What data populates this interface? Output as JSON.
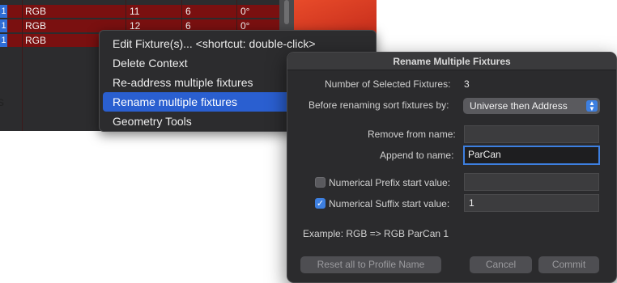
{
  "fixture_table": {
    "rows": [
      {
        "index": "1",
        "name": "RGB",
        "col2": "11",
        "col3": "6",
        "col4": "0°"
      },
      {
        "index": "1",
        "name": "RGB",
        "col2": "12",
        "col3": "6",
        "col4": "0°"
      },
      {
        "index": "1",
        "name": "RGB",
        "col2": "",
        "col3": "",
        "col4": ""
      }
    ]
  },
  "context_menu": {
    "items": [
      {
        "label": "Edit Fixture(s)...  <shortcut: double-click>",
        "highlighted": false
      },
      {
        "label": "Delete Context",
        "highlighted": false
      },
      {
        "label": "Re-address multiple fixtures",
        "highlighted": false
      },
      {
        "label": "Rename multiple fixtures",
        "highlighted": true
      },
      {
        "label": "Geometry Tools",
        "highlighted": false
      }
    ]
  },
  "dialog": {
    "title": "Rename Multiple Fixtures",
    "selected_count_label": "Number of Selected Fixtures:",
    "selected_count": "3",
    "sort_label": "Before renaming sort fixtures by:",
    "sort_value": "Universe then Address",
    "remove_label": "Remove from name:",
    "remove_value": "",
    "append_label": "Append to name:",
    "append_value": "ParCan",
    "prefix_label": "Numerical Prefix start value:",
    "prefix_checked": false,
    "prefix_value": "",
    "suffix_label": "Numerical Suffix start value:",
    "suffix_checked": true,
    "suffix_value": "1",
    "example_text": "Example:  RGB => RGB ParCan 1",
    "reset_button": "Reset all to Profile Name",
    "cancel_button": "Cancel",
    "commit_button": "Commit"
  },
  "colors": {
    "accent": "#3d7fe0",
    "row_red": "#7a1010",
    "menu_highlight": "#2a5fd0"
  }
}
